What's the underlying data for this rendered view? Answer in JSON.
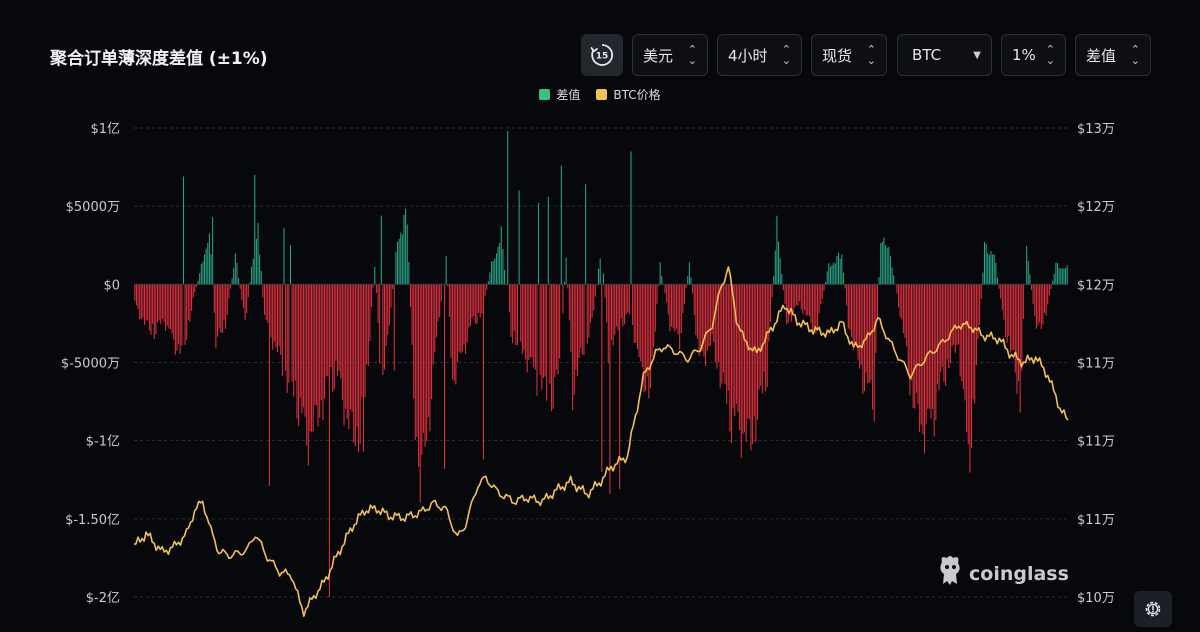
{
  "header": {
    "title": "聚合订单薄深度差值 (±1%)",
    "controls": {
      "interval_badge": "15",
      "currency": "美元",
      "timeframe": "4小时",
      "market": "现货",
      "coin": "BTC",
      "range": "1%",
      "metric": "差值"
    }
  },
  "watermark": "coinglass",
  "icons": {
    "interval": "replay-15-icon",
    "chevrons": "chevron-up-down-icon",
    "dropdown": "caret-down-icon",
    "logo": "coinglass-logo-icon",
    "settings": "settings-gear-icon"
  },
  "colors": {
    "positive": "#2aa487",
    "negative": "#e0313f",
    "price": "#f2c055",
    "legend_positive": "#36c285",
    "legend_price": "#f2c055",
    "grid": "#2b2e35",
    "background": "#07080b"
  },
  "chart_data": {
    "type": "bar",
    "legend": [
      "差值",
      "BTC价格"
    ],
    "legend_position": "top-center",
    "grid": true,
    "y_left": {
      "ticks": [
        "$1亿",
        "$5000万",
        "$0",
        "$-5000万",
        "$-1亿",
        "$-1.50亿",
        "$-2亿"
      ],
      "tick_values": [
        100000000,
        50000000,
        0,
        -50000000,
        -100000000,
        -150000000,
        -200000000
      ],
      "range": [
        -200000000,
        100000000
      ]
    },
    "y_right": {
      "ticks": [
        "$13万",
        "$12万",
        "$12万",
        "$11万",
        "$11万",
        "$11万",
        "$10万"
      ],
      "range": [
        105000,
        131000
      ]
    },
    "series": [
      {
        "name": "差值",
        "type": "bar",
        "keypoints": [
          [
            0,
            -10
          ],
          [
            6,
            -20
          ],
          [
            12,
            -25
          ],
          [
            18,
            -18
          ],
          [
            24,
            -30
          ],
          [
            30,
            -35
          ],
          [
            36,
            -8
          ],
          [
            42,
            12
          ],
          [
            46,
            28
          ],
          [
            50,
            -30
          ],
          [
            56,
            -20
          ],
          [
            62,
            15
          ],
          [
            68,
            -20
          ],
          [
            72,
            8
          ],
          [
            76,
            30
          ],
          [
            80,
            -18
          ],
          [
            86,
            -30
          ],
          [
            92,
            -45
          ],
          [
            100,
            -60
          ],
          [
            106,
            -80
          ],
          [
            112,
            -70
          ],
          [
            118,
            -55
          ],
          [
            124,
            -45
          ],
          [
            130,
            -65
          ],
          [
            136,
            -80
          ],
          [
            142,
            -60
          ],
          [
            148,
            10
          ],
          [
            152,
            -50
          ],
          [
            156,
            -30
          ],
          [
            162,
            25
          ],
          [
            168,
            35
          ],
          [
            172,
            -60
          ],
          [
            176,
            -100
          ],
          [
            180,
            -80
          ],
          [
            186,
            -30
          ],
          [
            192,
            15
          ],
          [
            196,
            -50
          ],
          [
            202,
            -35
          ],
          [
            208,
            -20
          ],
          [
            214,
            -15
          ],
          [
            220,
            10
          ],
          [
            226,
            25
          ],
          [
            232,
            -25
          ],
          [
            240,
            -35
          ],
          [
            246,
            -45
          ],
          [
            252,
            -55
          ],
          [
            258,
            -60
          ],
          [
            262,
            -40
          ],
          [
            266,
            15
          ],
          [
            270,
            -55
          ],
          [
            276,
            -35
          ],
          [
            282,
            -20
          ],
          [
            288,
            20
          ],
          [
            292,
            -35
          ],
          [
            300,
            -20
          ],
          [
            306,
            -15
          ],
          [
            312,
            -45
          ],
          [
            318,
            -55
          ],
          [
            324,
            10
          ],
          [
            330,
            -20
          ],
          [
            336,
            -30
          ],
          [
            342,
            12
          ],
          [
            348,
            -40
          ],
          [
            356,
            -30
          ],
          [
            362,
            -50
          ],
          [
            368,
            -70
          ],
          [
            374,
            -75
          ],
          [
            380,
            -80
          ],
          [
            386,
            -60
          ],
          [
            390,
            -45
          ],
          [
            396,
            30
          ],
          [
            402,
            -20
          ],
          [
            410,
            -10
          ],
          [
            420,
            -25
          ],
          [
            428,
            10
          ],
          [
            436,
            15
          ],
          [
            440,
            -20
          ],
          [
            446,
            -40
          ],
          [
            452,
            -55
          ],
          [
            456,
            -60
          ],
          [
            460,
            25
          ],
          [
            466,
            15
          ],
          [
            472,
            -15
          ],
          [
            480,
            -60
          ],
          [
            486,
            -75
          ],
          [
            492,
            -70
          ],
          [
            496,
            -55
          ],
          [
            502,
            -40
          ],
          [
            508,
            -30
          ],
          [
            514,
            -90
          ],
          [
            518,
            -60
          ],
          [
            524,
            20
          ],
          [
            530,
            15
          ],
          [
            536,
            -20
          ],
          [
            542,
            -40
          ],
          [
            546,
            -60
          ],
          [
            550,
            20
          ],
          [
            556,
            -25
          ],
          [
            562,
            -15
          ],
          [
            568,
            10
          ],
          [
            575,
            8
          ]
        ],
        "spikes": [
          [
            120,
            -200
          ],
          [
            139,
            -102
          ],
          [
            141,
            -107
          ],
          [
            83,
            -129
          ],
          [
            191,
            -118
          ],
          [
            215,
            -112
          ],
          [
            160,
            -55
          ],
          [
            30,
            69
          ],
          [
            74,
            70
          ],
          [
            48,
            43
          ],
          [
            96,
            25
          ],
          [
            230,
            98
          ],
          [
            237,
            60
          ],
          [
            255,
            56
          ],
          [
            263,
            76
          ],
          [
            249,
            52
          ],
          [
            278,
            64
          ],
          [
            293,
            -134
          ],
          [
            299,
            -131
          ],
          [
            306,
            85
          ],
          [
            288,
            -120
          ],
          [
            152,
            44
          ],
          [
            92,
            36
          ]
        ]
      },
      {
        "name": "BTC价格",
        "type": "line",
        "keypoints": [
          [
            0,
            107800
          ],
          [
            6,
            108500
          ],
          [
            10,
            108000
          ],
          [
            14,
            107500
          ],
          [
            20,
            107800
          ],
          [
            26,
            108500
          ],
          [
            30,
            109800
          ],
          [
            34,
            110300
          ],
          [
            38,
            108700
          ],
          [
            42,
            107500
          ],
          [
            48,
            107300
          ],
          [
            56,
            107600
          ],
          [
            60,
            108500
          ],
          [
            66,
            107200
          ],
          [
            72,
            106400
          ],
          [
            78,
            106200
          ],
          [
            82,
            104700
          ],
          [
            84,
            104200
          ],
          [
            86,
            104500
          ],
          [
            90,
            105200
          ],
          [
            94,
            105800
          ],
          [
            100,
            107200
          ],
          [
            108,
            108900
          ],
          [
            114,
            109800
          ],
          [
            120,
            109900
          ],
          [
            126,
            109500
          ],
          [
            134,
            109400
          ],
          [
            142,
            109700
          ],
          [
            148,
            110200
          ],
          [
            154,
            109900
          ],
          [
            160,
            108300
          ],
          [
            164,
            109000
          ],
          [
            170,
            111200
          ],
          [
            174,
            111600
          ],
          [
            180,
            110800
          ],
          [
            188,
            110300
          ],
          [
            194,
            110500
          ],
          [
            202,
            110300
          ],
          [
            210,
            111000
          ],
          [
            216,
            111400
          ],
          [
            224,
            110700
          ],
          [
            230,
            111300
          ],
          [
            236,
            112200
          ],
          [
            244,
            112800
          ],
          [
            252,
            117200
          ],
          [
            258,
            118500
          ],
          [
            262,
            118900
          ],
          [
            268,
            118600
          ],
          [
            274,
            118200
          ],
          [
            280,
            118800
          ],
          [
            286,
            120100
          ],
          [
            290,
            122000
          ],
          [
            294,
            123300
          ],
          [
            298,
            120400
          ],
          [
            302,
            119200
          ],
          [
            308,
            118500
          ],
          [
            316,
            120000
          ],
          [
            322,
            121200
          ],
          [
            328,
            120300
          ],
          [
            336,
            119800
          ],
          [
            344,
            119600
          ],
          [
            350,
            120200
          ],
          [
            356,
            118800
          ],
          [
            362,
            119200
          ],
          [
            368,
            120400
          ],
          [
            376,
            118700
          ],
          [
            384,
            117300
          ],
          [
            392,
            118300
          ],
          [
            400,
            119100
          ],
          [
            408,
            120100
          ],
          [
            414,
            120000
          ],
          [
            420,
            119500
          ],
          [
            428,
            119300
          ],
          [
            434,
            118400
          ],
          [
            440,
            118000
          ],
          [
            446,
            118300
          ],
          [
            452,
            117300
          ],
          [
            458,
            115500
          ],
          [
            462,
            114700
          ]
        ]
      }
    ]
  }
}
